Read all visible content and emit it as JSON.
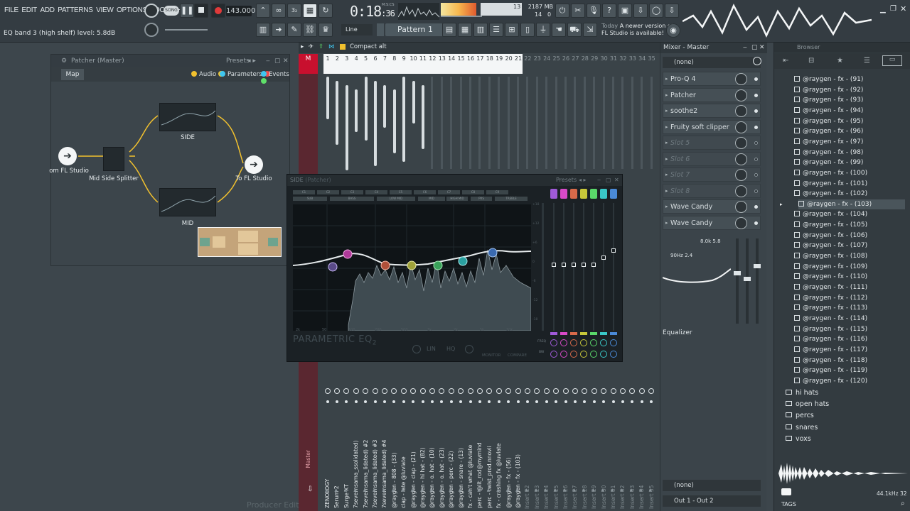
{
  "menu": [
    "FILE",
    "EDIT",
    "ADD",
    "PATTERNS",
    "VIEW",
    "OPTIONS",
    "TOOLS",
    "HELP"
  ],
  "hint_text": "EQ band 3 (high shelf) level: 5.8dB",
  "transport": {
    "song_label": "SONG",
    "tempo": "143.000",
    "time": "0:18",
    "time_small": ":36",
    "time_unit": "M:S:CS"
  },
  "meters": {
    "cpu_value": "13",
    "poly_value": "14",
    "memory": "2187 MB",
    "memory_sub": "0"
  },
  "snap_label": "Line",
  "pattern_label": "Pattern 1",
  "news": {
    "today": "Today",
    "line1": "A newer version of",
    "line2": "FL Studio is available!"
  },
  "patcher": {
    "title": "Patcher (Master)",
    "presets": "Presets",
    "map_tab": "Map",
    "legend_audio": "Audio",
    "legend_parameters": "Parameters",
    "legend_events": "Events",
    "nodes": {
      "from": "om FL Studio",
      "splitter": "Mid Side Splitter",
      "side": "SIDE",
      "mid": "MID",
      "to": "To FL Studio"
    }
  },
  "playlist": {
    "view_label": "Compact alt",
    "ruler": [
      "1",
      "2",
      "3",
      "4",
      "5",
      "6",
      "7",
      "8",
      "9",
      "10",
      "11",
      "12",
      "13",
      "14",
      "15",
      "16",
      "17",
      "18",
      "19",
      "20",
      "21",
      "22",
      "23",
      "24",
      "25",
      "26",
      "27",
      "28",
      "29",
      "30",
      "31",
      "32",
      "33",
      "34",
      "35"
    ],
    "master_label": "M",
    "master_name": "Master",
    "channels": [
      "ZENOLOGY",
      "Serum 2",
      "Surge XT",
      "7severnsama_ssolidated)",
      "7severnsama_lidated) #2",
      "7severnsama_lidated) #3",
      "7severnsama_lidated) #4",
      "@raygen - 808 - (33)",
      "clap - late @luvlate",
      "@raygen - clap - (21)",
      "@raygen - hi hat - (82)",
      "@raygen - o. hat - (10)",
      "@raygen - o. hat - (23)",
      "@raygen - perc - (22)",
      "@raygen - snare - (13)",
      "fx - can't what @luvlate",
      "perc - @lit_rod@mymind",
      "perc - twist_prod.nnovii",
      "fx - crashing fx @luvlate",
      "@raygen - fx - (56)",
      "@raygen - fx - (103)"
    ],
    "inserts": [
      "Insert 22",
      "Insert 23",
      "Insert 24",
      "Insert 25",
      "Insert 26",
      "Insert 27",
      "Insert 28",
      "Insert 29",
      "Insert 30",
      "Insert 31",
      "Insert 32",
      "Insert 33",
      "Insert 34",
      "Insert 35"
    ]
  },
  "eq": {
    "title": "SIDE",
    "title_sub": "(Patcher)",
    "presets": "Presets",
    "bands": [
      "C1",
      "C2",
      "C3",
      "C4",
      "C5",
      "C6",
      "C7",
      "C8",
      "C9"
    ],
    "regions": [
      "SUB",
      "BASS",
      "LOW MID",
      "MID",
      "HIGH MID",
      "PRS",
      "TREBLE"
    ],
    "brand": "PARAMETRIC EQ",
    "brand_num": "2",
    "buttons": [
      "LIN",
      "HQ"
    ],
    "monitor": "MONITOR",
    "compare": "COMPARE",
    "freq_labels": [
      "2k",
      "50",
      "100",
      "200",
      "500",
      "1k",
      "2k",
      "5k",
      "10k"
    ],
    "db_labels": [
      "+18",
      "+12",
      "+6",
      "0",
      "-6",
      "-12",
      "-18"
    ],
    "side_freq": "FREQ",
    "side_bw": "BW"
  },
  "mixer": {
    "title": "Mixer - Master",
    "input": "(none)",
    "slots": [
      {
        "name": "Pro-Q 4",
        "empty": false
      },
      {
        "name": "Patcher",
        "empty": false
      },
      {
        "name": "soothe2",
        "empty": false
      },
      {
        "name": "Fruity soft clipper",
        "empty": false
      },
      {
        "name": "Slot 5",
        "empty": true
      },
      {
        "name": "Slot 6",
        "empty": true
      },
      {
        "name": "Slot 7",
        "empty": true
      },
      {
        "name": "Slot 8",
        "empty": true
      },
      {
        "name": "Wave Candy",
        "empty": false
      },
      {
        "name": "Wave Candy",
        "empty": false
      }
    ],
    "eq_hi": "8.0k 5.8",
    "eq_lo": "90Hz 2.4",
    "eq_label": "Equalizer",
    "output_send": "(none)",
    "output": "Out 1 - Out 2"
  },
  "browser": {
    "title": "Browser",
    "files": [
      "@raygen - fx - (91)",
      "@raygen - fx - (92)",
      "@raygen - fx - (93)",
      "@raygen - fx - (94)",
      "@raygen - fx - (95)",
      "@raygen - fx - (96)",
      "@raygen - fx - (97)",
      "@raygen - fx - (98)",
      "@raygen - fx - (99)",
      "@raygen - fx - (100)",
      "@raygen - fx - (101)",
      "@raygen - fx - (102)",
      "@raygen - fx - (103)",
      "@raygen - fx - (104)",
      "@raygen - fx - (105)",
      "@raygen - fx - (106)",
      "@raygen - fx - (107)",
      "@raygen - fx - (108)",
      "@raygen - fx - (109)",
      "@raygen - fx - (110)",
      "@raygen - fx - (111)",
      "@raygen - fx - (112)",
      "@raygen - fx - (113)",
      "@raygen - fx - (114)",
      "@raygen - fx - (115)",
      "@raygen - fx - (116)",
      "@raygen - fx - (117)",
      "@raygen - fx - (118)",
      "@raygen - fx - (119)",
      "@raygen - fx - (120)"
    ],
    "selected": "@raygen - fx - (103)",
    "folders": [
      "hi hats",
      "open hats",
      "percs",
      "snares",
      "voxs"
    ],
    "tags": "TAGS",
    "sample_rate": "44.1kHz 32"
  },
  "footer_hint": "Producer Edit"
}
